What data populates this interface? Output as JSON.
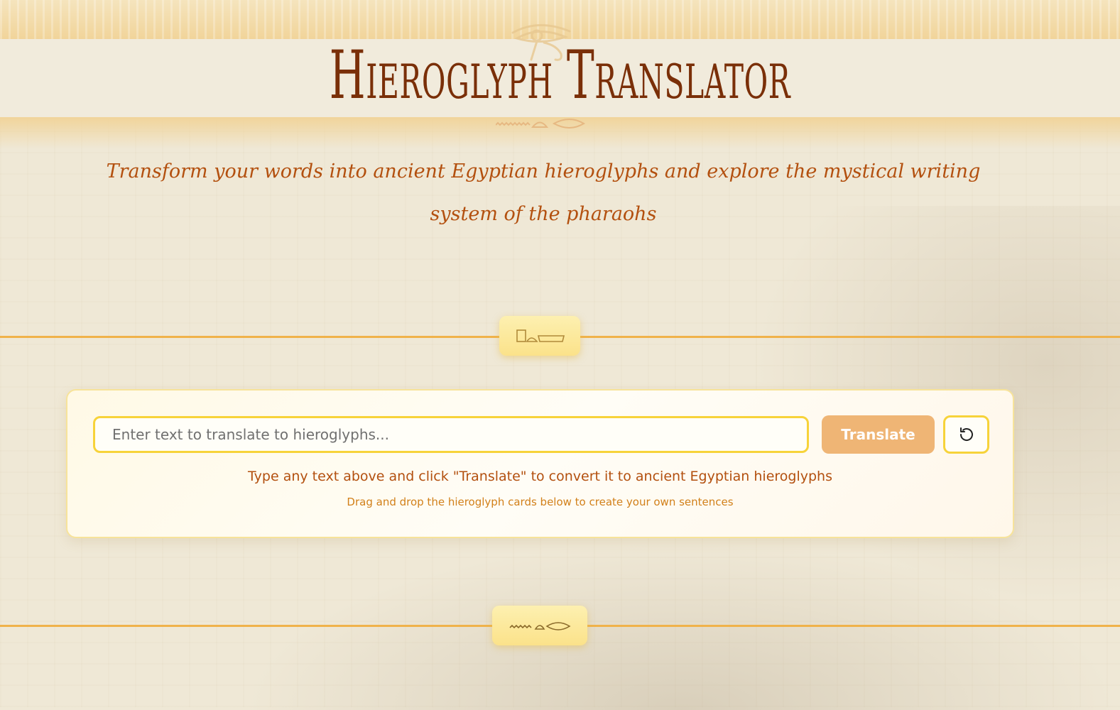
{
  "header": {
    "title": "Hieroglyph Translator",
    "subtitle": "Transform your words into ancient Egyptian hieroglyphs and explore the mystical writing system of the pharaohs",
    "emblem_icon": "eye-of-horus-icon"
  },
  "dividers": [
    {
      "glyphs_icon": "hieroglyph-divider-icon-1"
    },
    {
      "glyphs_icon": "hieroglyph-divider-icon-2"
    }
  ],
  "translator": {
    "input_value": "",
    "input_placeholder": "Enter text to translate to hieroglyphs...",
    "translate_label": "Translate",
    "reset_icon": "reset-icon",
    "hint_main": "Type any text above and click \"Translate\" to convert it to ancient Egyptian hieroglyphs",
    "hint_sub": "Drag and drop the hieroglyph cards below to create your own sentences"
  },
  "colors": {
    "title": "#7a2f08",
    "subtitle": "#b3500f",
    "accent_gold": "#f7d33a",
    "button": "#efb575",
    "divider": "#f0b24a"
  }
}
